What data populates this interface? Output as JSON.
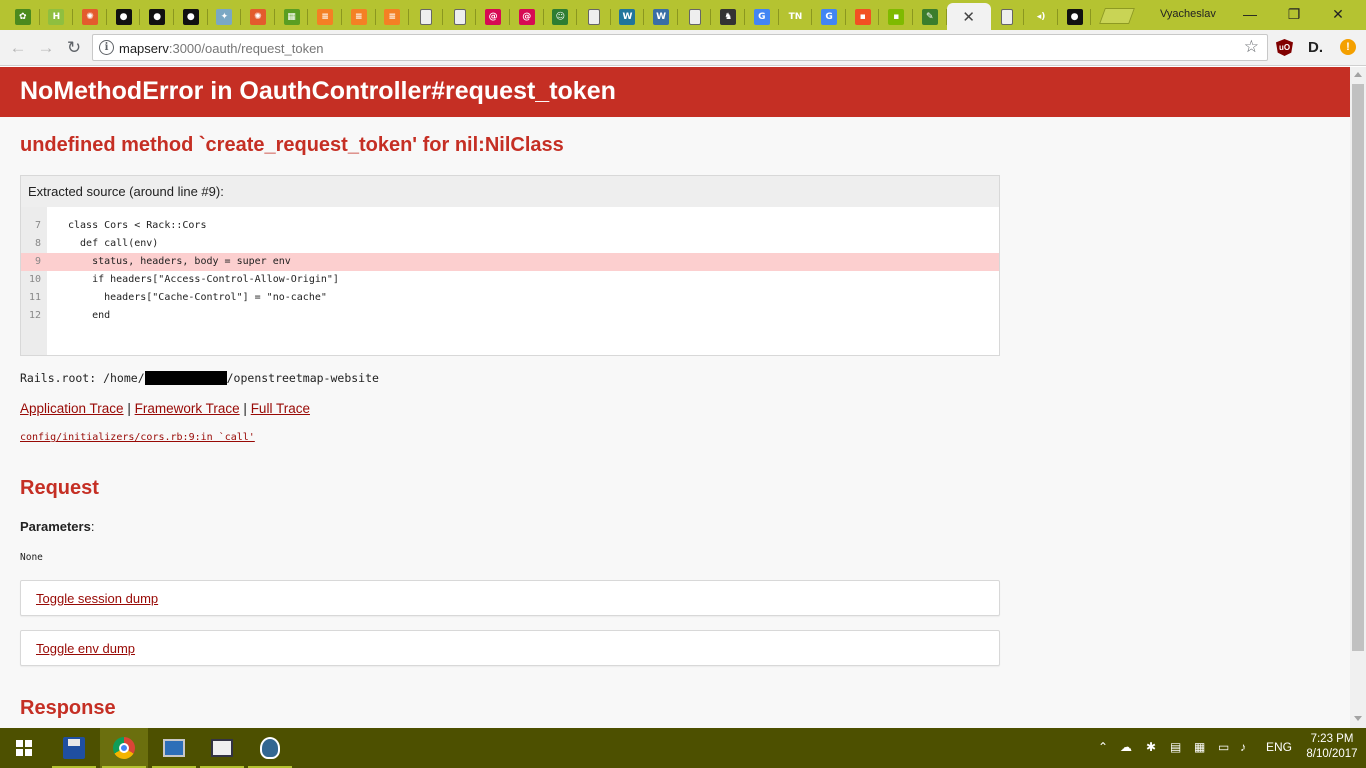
{
  "browser": {
    "tabs": [
      {
        "icon": "osm-icon",
        "color": "#4b8a1e",
        "glyph": "✿"
      },
      {
        "icon": "h-icon",
        "color": "#8fbf3f",
        "glyph": "H"
      },
      {
        "icon": "redmine-icon",
        "color": "#e35b2d",
        "glyph": "✺"
      },
      {
        "icon": "github-icon",
        "color": "#111111",
        "glyph": "●"
      },
      {
        "icon": "github-icon",
        "color": "#111111",
        "glyph": "●"
      },
      {
        "icon": "github-icon",
        "color": "#111111",
        "glyph": "●"
      },
      {
        "icon": "osm-icon",
        "color": "#7aa8c4",
        "glyph": "✦"
      },
      {
        "icon": "redmine-icon",
        "color": "#e35b2d",
        "glyph": "✺"
      },
      {
        "icon": "osm-edit-icon",
        "color": "#5a9e22",
        "glyph": "▦"
      },
      {
        "icon": "stackoverflow-icon",
        "color": "#f48024",
        "glyph": "≡"
      },
      {
        "icon": "stackoverflow-icon",
        "color": "#f48024",
        "glyph": "≡"
      },
      {
        "icon": "stackoverflow-icon",
        "color": "#f48024",
        "glyph": "≡"
      },
      {
        "icon": "page-icon",
        "color": "#eeeeee",
        "glyph": ""
      },
      {
        "icon": "page-icon",
        "color": "#eeeeee",
        "glyph": ""
      },
      {
        "icon": "debian-icon",
        "color": "#d70a53",
        "glyph": "@"
      },
      {
        "icon": "debian-icon",
        "color": "#d70a53",
        "glyph": "@"
      },
      {
        "icon": "owl-icon",
        "color": "#2e7d32",
        "glyph": "☺"
      },
      {
        "icon": "page-icon",
        "color": "#eeeeee",
        "glyph": ""
      },
      {
        "icon": "wordpress-icon",
        "color": "#21759b",
        "glyph": "W"
      },
      {
        "icon": "wikipedia-icon",
        "color": "#3a6ea5",
        "glyph": "W"
      },
      {
        "icon": "page-icon",
        "color": "#eeeeee",
        "glyph": ""
      },
      {
        "icon": "gnu-icon",
        "color": "#333333",
        "glyph": "♞"
      },
      {
        "icon": "google-icon",
        "color": "#4285f4",
        "glyph": "G"
      },
      {
        "icon": "tn-icon",
        "color": "#b5c331",
        "glyph": "TN"
      },
      {
        "icon": "google-icon",
        "color": "#4285f4",
        "glyph": "G"
      },
      {
        "icon": "microsoft-icon",
        "color": "#f25022",
        "glyph": "▪"
      },
      {
        "icon": "microsoft-icon",
        "color": "#7fba00",
        "glyph": "▪"
      },
      {
        "icon": "tools-icon",
        "color": "#3a7d2c",
        "glyph": "✎"
      },
      {
        "icon": "page-icon",
        "color": "#eeeeee",
        "glyph": ""
      },
      {
        "icon": "audio-icon",
        "color": "#b5c331",
        "glyph": "◂)"
      },
      {
        "icon": "github-icon",
        "color": "#111111",
        "glyph": "●"
      }
    ],
    "active_tab_close": "✕",
    "profile_name": "Vyacheslav",
    "url_host": "mapserv",
    "url_rest": ":3000/oauth/request_token",
    "window": {
      "minimize": "—",
      "restore": "❐",
      "close": "✕"
    }
  },
  "page": {
    "title": "NoMethodError in OauthController#request_token",
    "message": "undefined method `create_request_token' for nil:NilClass",
    "source_title": "Extracted source (around line #9):",
    "source_lines": [
      {
        "num": "7",
        "code": "class Cors < Rack::Cors",
        "highlight": false
      },
      {
        "num": "8",
        "code": "  def call(env)",
        "highlight": false
      },
      {
        "num": "9",
        "code": "    status, headers, body = super env",
        "highlight": true
      },
      {
        "num": "10",
        "code": "    if headers[\"Access-Control-Allow-Origin\"]",
        "highlight": false
      },
      {
        "num": "11",
        "code": "      headers[\"Cache-Control\"] = \"no-cache\"",
        "highlight": false
      },
      {
        "num": "12",
        "code": "    end",
        "highlight": false
      }
    ],
    "rails_root_prefix": "Rails.root: /home/",
    "rails_root_suffix": "/openstreetmap-website",
    "trace_links": {
      "application": "Application Trace",
      "framework": "Framework Trace",
      "full": "Full Trace",
      "separator": "|"
    },
    "trace_line": "config/initializers/cors.rb:9:in `call'",
    "request_heading": "Request",
    "parameters_label": "Parameters",
    "parameters_colon": ":",
    "parameters_value": "None",
    "toggle_session": "Toggle session dump",
    "toggle_env": "Toggle env dump",
    "response_heading": "Response"
  },
  "taskbar": {
    "language": "ENG",
    "time": "7:23 PM",
    "date": "8/10/2017"
  },
  "colors": {
    "chrome_theme": "#b5c331",
    "error_red": "#c52f24",
    "link_red": "#980905",
    "highlight_line": "#fccfcf",
    "taskbar": "#4d5000"
  }
}
